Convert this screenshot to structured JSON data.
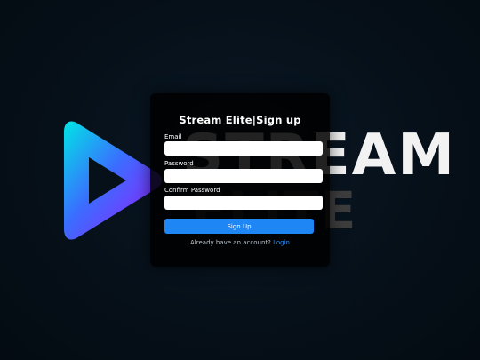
{
  "background": {
    "brand_word_top": "STREAM",
    "brand_word_bottom": "ELITE",
    "logo_icon": "play-triangle-icon",
    "gradient_colors": [
      "#00e5e5",
      "#8a1cff"
    ]
  },
  "card": {
    "title": "Stream Elite|Sign up",
    "fields": [
      {
        "label": "Email",
        "value": "",
        "placeholder": ""
      },
      {
        "label": "Password",
        "value": "",
        "placeholder": ""
      },
      {
        "label": "Confirm Password",
        "value": "",
        "placeholder": ""
      }
    ],
    "submit_label": "Sign Up",
    "login_prompt": "Already have an account?",
    "login_link": "Login",
    "accent_color": "#1f86f5"
  }
}
